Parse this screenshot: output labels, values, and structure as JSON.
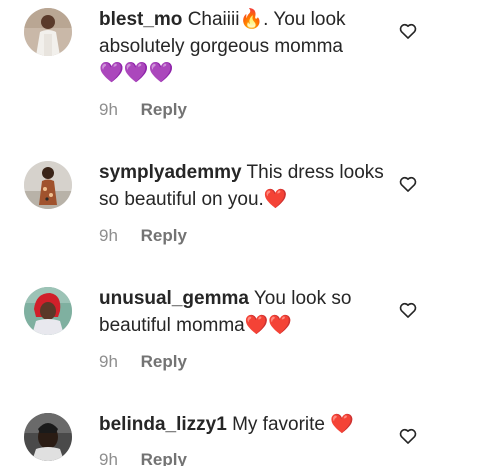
{
  "comments": [
    {
      "username": "blest_mo",
      "text_before_emoji": "Chaiiii",
      "inline_emoji": "🔥",
      "text_after_emoji": ". You look absolutely gorgeous momma",
      "trailing_emoji": "💜💜💜",
      "time": "9h",
      "reply_label": "Reply",
      "avatar_icon": "avatar-person-white-outfit",
      "like_icon": "heart-outline-icon"
    },
    {
      "username": "symplyademmy",
      "text_before_emoji": "This dress looks so beautiful on you.",
      "inline_emoji": "❤️",
      "text_after_emoji": "",
      "trailing_emoji": "",
      "time": "9h",
      "reply_label": "Reply",
      "avatar_icon": "avatar-person-printed-dress",
      "like_icon": "heart-outline-icon"
    },
    {
      "username": "unusual_gemma",
      "text_before_emoji": "You look so beautiful momma",
      "inline_emoji": "❤️❤️",
      "text_after_emoji": "",
      "trailing_emoji": "",
      "time": "9h",
      "reply_label": "Reply",
      "avatar_icon": "avatar-person-red-hair",
      "like_icon": "heart-outline-icon"
    },
    {
      "username": "belinda_lizzy1",
      "text_before_emoji": "My favorite",
      "inline_emoji": "❤️",
      "text_after_emoji": "",
      "trailing_emoji": "",
      "time": "9h",
      "reply_label": "Reply",
      "avatar_icon": "avatar-person-dark-photo",
      "like_icon": "heart-outline-icon"
    }
  ],
  "colors": {
    "text": "#262626",
    "secondary_text": "#8e8e8e",
    "heart_emoji": "#e0242e"
  }
}
